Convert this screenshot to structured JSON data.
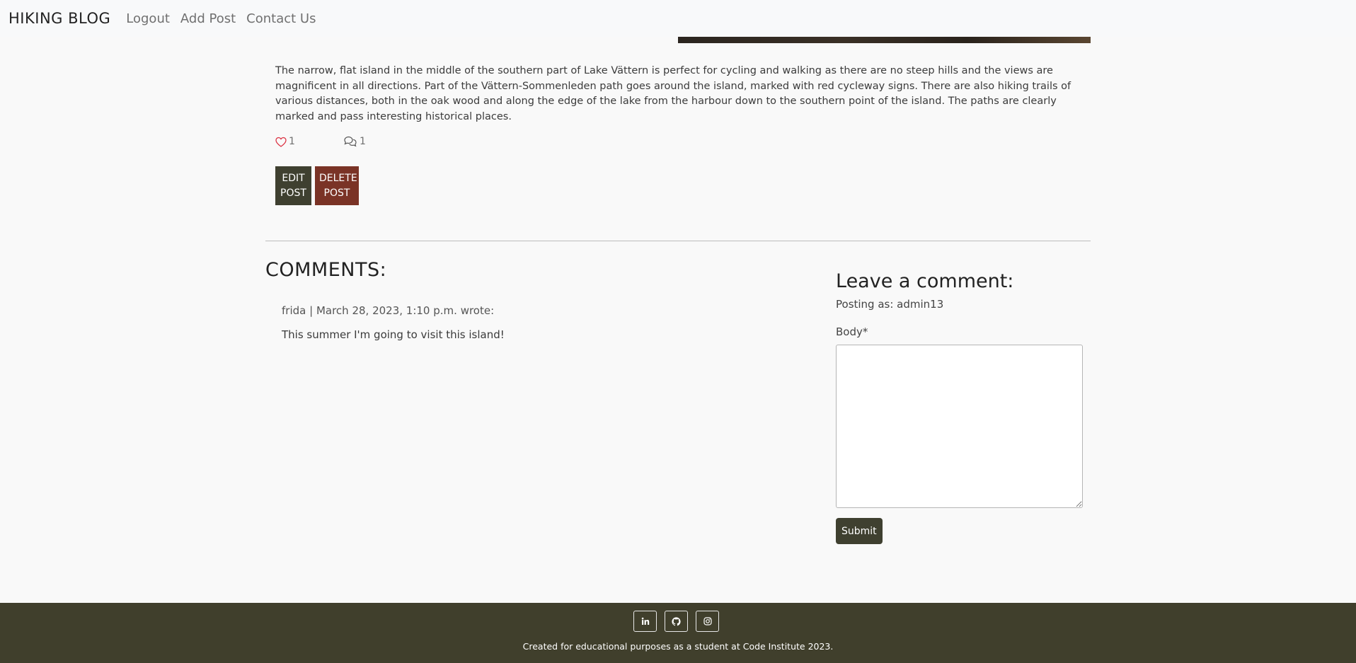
{
  "navbar": {
    "brand": "HIKING BLOG",
    "links": [
      {
        "label": "Logout"
      },
      {
        "label": "Add Post"
      },
      {
        "label": "Contact Us"
      }
    ]
  },
  "post": {
    "content": "The narrow, flat island in the middle of the southern part of Lake Vättern is perfect for cycling and walking as there are no steep hills and the views are magnificent in all directions. Part of the Vättern-Sommenleden path goes around the island, marked with red cycleway signs. There are also hiking trails of various distances, both in the oak wood and along the edge of the lake from the harbour down to the southern point of the island. The paths are clearly marked and pass interesting historical places.",
    "likes": "1",
    "comment_count": "1",
    "like_icon": "heart-icon",
    "comment_icon": "comments-icon",
    "edit_label_1": "EDIT",
    "edit_label_2": "POST",
    "delete_label_1": "DELETE",
    "delete_label_2": "POST"
  },
  "comments": {
    "title": "COMMENTS:",
    "items": [
      {
        "author": "frida",
        "date": "March 28, 2023, 1:10 p.m.",
        "suffix": "wrote:",
        "body": "This summer I'm going to visit this island!"
      }
    ]
  },
  "comment_form": {
    "title": "Leave a comment:",
    "posting_as": "Posting as: admin13",
    "body_label": "Body*",
    "body_value": "",
    "submit_label": "Submit"
  },
  "footer": {
    "socials": [
      {
        "icon": "linkedin-icon"
      },
      {
        "icon": "github-icon"
      },
      {
        "icon": "instagram-icon"
      }
    ],
    "text": "Created for educational purposes as a student at Code Institute 2023."
  },
  "colors": {
    "accent_dark": "#3f4030",
    "delete_red": "#7a3326",
    "like_red": "#dc3545",
    "footer_bg": "#403f2c"
  }
}
